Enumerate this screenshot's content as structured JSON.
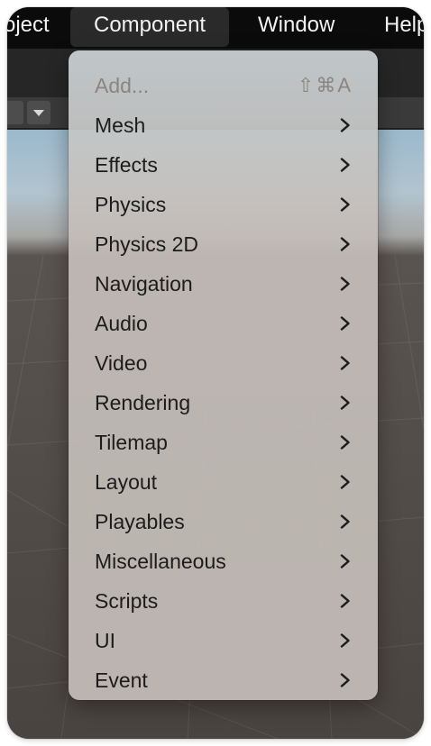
{
  "menubar": {
    "items": [
      {
        "label": "oject",
        "active": false
      },
      {
        "label": "Component",
        "active": true
      },
      {
        "label": "Window",
        "active": false
      },
      {
        "label": "Help",
        "active": false
      }
    ]
  },
  "component_menu": {
    "add": {
      "label": "Add...",
      "shortcut": "⇧⌘A",
      "enabled": false
    },
    "items": [
      {
        "label": "Mesh",
        "icon": "chevron-right-icon"
      },
      {
        "label": "Effects",
        "icon": "chevron-right-icon"
      },
      {
        "label": "Physics",
        "icon": "chevron-right-icon"
      },
      {
        "label": "Physics 2D",
        "icon": "chevron-right-icon"
      },
      {
        "label": "Navigation",
        "icon": "chevron-right-icon"
      },
      {
        "label": "Audio",
        "icon": "chevron-right-icon"
      },
      {
        "label": "Video",
        "icon": "chevron-right-icon"
      },
      {
        "label": "Rendering",
        "icon": "chevron-right-icon"
      },
      {
        "label": "Tilemap",
        "icon": "chevron-right-icon"
      },
      {
        "label": "Layout",
        "icon": "chevron-right-icon"
      },
      {
        "label": "Playables",
        "icon": "chevron-right-icon"
      },
      {
        "label": "Miscellaneous",
        "icon": "chevron-right-icon"
      },
      {
        "label": "Scripts",
        "icon": "chevron-right-icon"
      },
      {
        "label": "UI",
        "icon": "chevron-right-icon"
      },
      {
        "label": "Event",
        "icon": "chevron-right-icon"
      }
    ]
  },
  "colors": {
    "menubar_bg": "#0b0b0b",
    "menu_bg": "#c4beba",
    "menu_text": "#1c1c1c",
    "menu_disabled_text": "#8a8580",
    "sky": "#9bb9cc",
    "ground": "#4a4441"
  }
}
